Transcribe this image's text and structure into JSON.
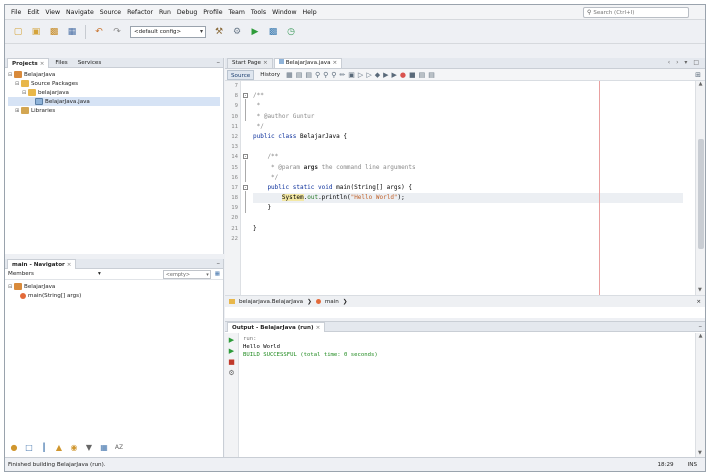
{
  "menu": [
    "File",
    "Edit",
    "View",
    "Navigate",
    "Source",
    "Refactor",
    "Run",
    "Debug",
    "Profile",
    "Team",
    "Tools",
    "Window",
    "Help"
  ],
  "search": {
    "placeholder": "Search (Ctrl+I)"
  },
  "toolbar": {
    "config": "<default config>"
  },
  "projects": {
    "tabs": [
      "Projects",
      "Files",
      "Services"
    ],
    "tree": {
      "project": "BelajarJava",
      "source_packages": "Source Packages",
      "package": "belajarjava",
      "file": "BelajarJava.java",
      "libraries": "Libraries"
    }
  },
  "navigator": {
    "title": "main - Navigator",
    "members_label": "Members",
    "filter": "<empty>",
    "class_name": "BelajarJava",
    "method": "main(String[] args)"
  },
  "editor": {
    "tabs": [
      "Start Page",
      "BelajarJava.java"
    ],
    "view_tabs": [
      "Source",
      "History"
    ],
    "line_numbers": [
      "7",
      "8",
      "9",
      "10",
      "11",
      "12",
      "13",
      "14",
      "15",
      "16",
      "17",
      "18",
      "19",
      "20",
      "21",
      "22"
    ],
    "code": {
      "l8": "/**",
      "l9": " *",
      "l10": " * @author Guntur",
      "l11": " */",
      "l12_kw": "public class",
      "l12_name": " BelajarJava {",
      "l14": "    /**",
      "l15_a": "     * @param ",
      "l15_b": "args",
      "l15_c": " the command line arguments",
      "l16": "     */",
      "l17_kw": "    public static void",
      "l17_rest": " main(String[] args) {",
      "l18_sys": "System",
      "l18_dot": ".",
      "l18_out": "out",
      "l18_print": ".println(",
      "l18_str": "\"Hello World\"",
      "l18_end": ");",
      "l19": "    }",
      "l21": "}"
    }
  },
  "breadcrumbs": [
    "belajarjava.BelajarJava",
    "main"
  ],
  "output": {
    "title": "Output - BelajarJava (run)",
    "lines": [
      "run:",
      "Hello World",
      "BUILD SUCCESSFUL (total time: 0 seconds)"
    ]
  },
  "status": {
    "message": "Finished building BelajarJava (run).",
    "position": "18:29",
    "mode": "INS"
  }
}
